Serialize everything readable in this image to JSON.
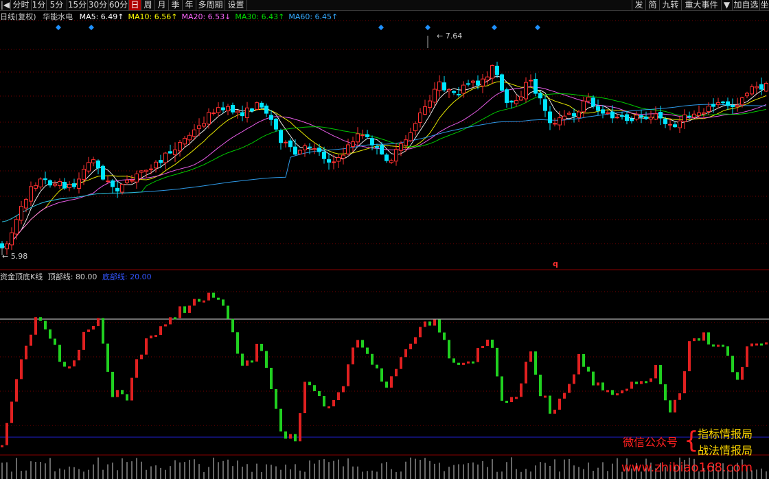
{
  "toolbar": {
    "left_items": [
      "|◀",
      "分时",
      "1分",
      "5分",
      "15分",
      "30分",
      "60分",
      "日",
      "周",
      "月",
      "季",
      "年",
      "多周期",
      "设置"
    ],
    "active": "日",
    "right_items": [
      "发",
      "简",
      "九转",
      "重大事件",
      "▼",
      "加自选",
      "坐"
    ]
  },
  "main_panel": {
    "period": "日线(复权)",
    "stock_name": "华能水电",
    "ma": [
      {
        "label": "MA5:",
        "value": "6.49",
        "arrow": "↑",
        "color": "#ffffff"
      },
      {
        "label": "MA10:",
        "value": "6.56",
        "arrow": "↑",
        "color": "#ffff00"
      },
      {
        "label": "MA20:",
        "value": "6.53",
        "arrow": "↓",
        "color": "#ff66ff"
      },
      {
        "label": "MA30:",
        "value": "6.43",
        "arrow": "↑",
        "color": "#00e000"
      },
      {
        "label": "MA60:",
        "value": "6.45",
        "arrow": "↑",
        "color": "#33aaff"
      }
    ],
    "high_label": "7.64",
    "low_label": "5.98",
    "marker_q": "q"
  },
  "indicator_panel": {
    "name": "资金顶底K线",
    "top_label": "顶部线:",
    "top_value": "80.00",
    "bottom_label": "底部线:",
    "bottom_value": "20.00"
  },
  "watermark": {
    "wechat": "微信公众号",
    "brace": "{",
    "line1": "指标情报局",
    "line2": "战法情报局",
    "url": "www.zhibiao168.com"
  },
  "colors": {
    "up": "#ff3030",
    "down": "#00e5ff",
    "ind_up": "#e02020",
    "ind_down": "#20d020",
    "top_line": "#dddddd",
    "bottom_line": "#2020d0",
    "grid": "#7a0000"
  },
  "chart_data": {
    "type": "candlestick",
    "price_range": [
      5.98,
      7.64
    ],
    "indicator_range": [
      0,
      100
    ],
    "top_line": 80,
    "bottom_line": 20
  }
}
